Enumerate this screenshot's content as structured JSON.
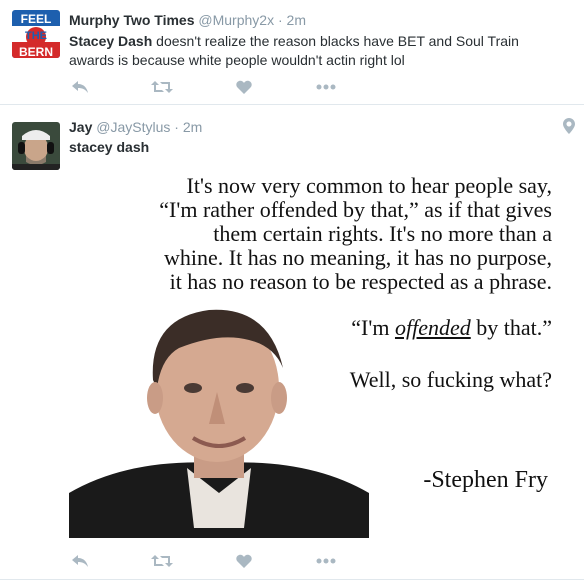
{
  "tweets": [
    {
      "avatar": "feel-the-bern-avatar",
      "avatar_text": "FEEL THE BERN",
      "name": "Murphy Two Times",
      "handle": "@Murphy2x",
      "separator": "·",
      "time": "2m",
      "mention": "Stacey Dash",
      "text": " doesn't realize the reason blacks have BET and Soul Train awards is because white people wouldn't actin right lol"
    },
    {
      "avatar": "man-headphones-avatar",
      "name": "Jay",
      "handle": "@JayStylus",
      "separator": "·",
      "time": "2m",
      "text": "stacey dash",
      "location_icon": "map-pin-icon",
      "media": {
        "quote_lines": [
          "It's now very common to hear people say,",
          "“I'm rather offended by that,” as if that gives",
          "them certain rights. It's no more than a",
          "whine. It has no meaning, it has no purpose,",
          "it has no reason to be respected as a phrase."
        ],
        "offended_pre": "“I'm ",
        "offended_word": "offended",
        "offended_post": " by that.”",
        "so_what": "Well, so fucking what?",
        "author": "-Stephen Fry"
      }
    }
  ],
  "actions": [
    "reply-icon",
    "retweet-icon",
    "like-icon",
    "more-icon"
  ],
  "colors": {
    "icon": "#aab8c2",
    "meta": "#8899a6",
    "text": "#292f33",
    "divider": "#e1e8ed"
  }
}
